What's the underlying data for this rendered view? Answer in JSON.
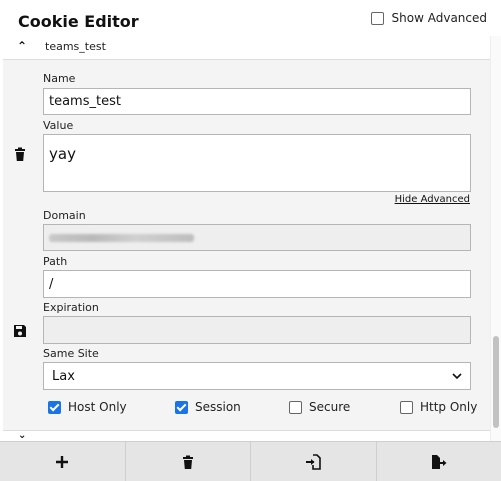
{
  "header": {
    "title": "Cookie Editor",
    "show_advanced_label": "Show Advanced",
    "show_advanced_checked": false
  },
  "cookie": {
    "name_heading": "teams_test",
    "fields": {
      "name_label": "Name",
      "name_value": "teams_test",
      "value_label": "Value",
      "value_value": "yay",
      "hide_advanced_label": "Hide Advanced",
      "domain_label": "Domain",
      "path_label": "Path",
      "path_value": "/",
      "expiration_label": "Expiration",
      "expiration_value": "",
      "same_site_label": "Same Site",
      "same_site_value": "Lax"
    },
    "options": [
      {
        "label": "Host Only",
        "checked": true
      },
      {
        "label": "Session",
        "checked": true
      },
      {
        "label": "Secure",
        "checked": false
      },
      {
        "label": "Http Only",
        "checked": false
      }
    ],
    "side_icons": [
      "trash-icon",
      "save-icon"
    ]
  },
  "footer": {
    "buttons": [
      "add-icon",
      "delete-all-icon",
      "import-icon",
      "export-icon"
    ]
  },
  "colors": {
    "accent": "#1a73e8",
    "panel": "#f4f4f4",
    "footer": "#e5e5e5"
  }
}
